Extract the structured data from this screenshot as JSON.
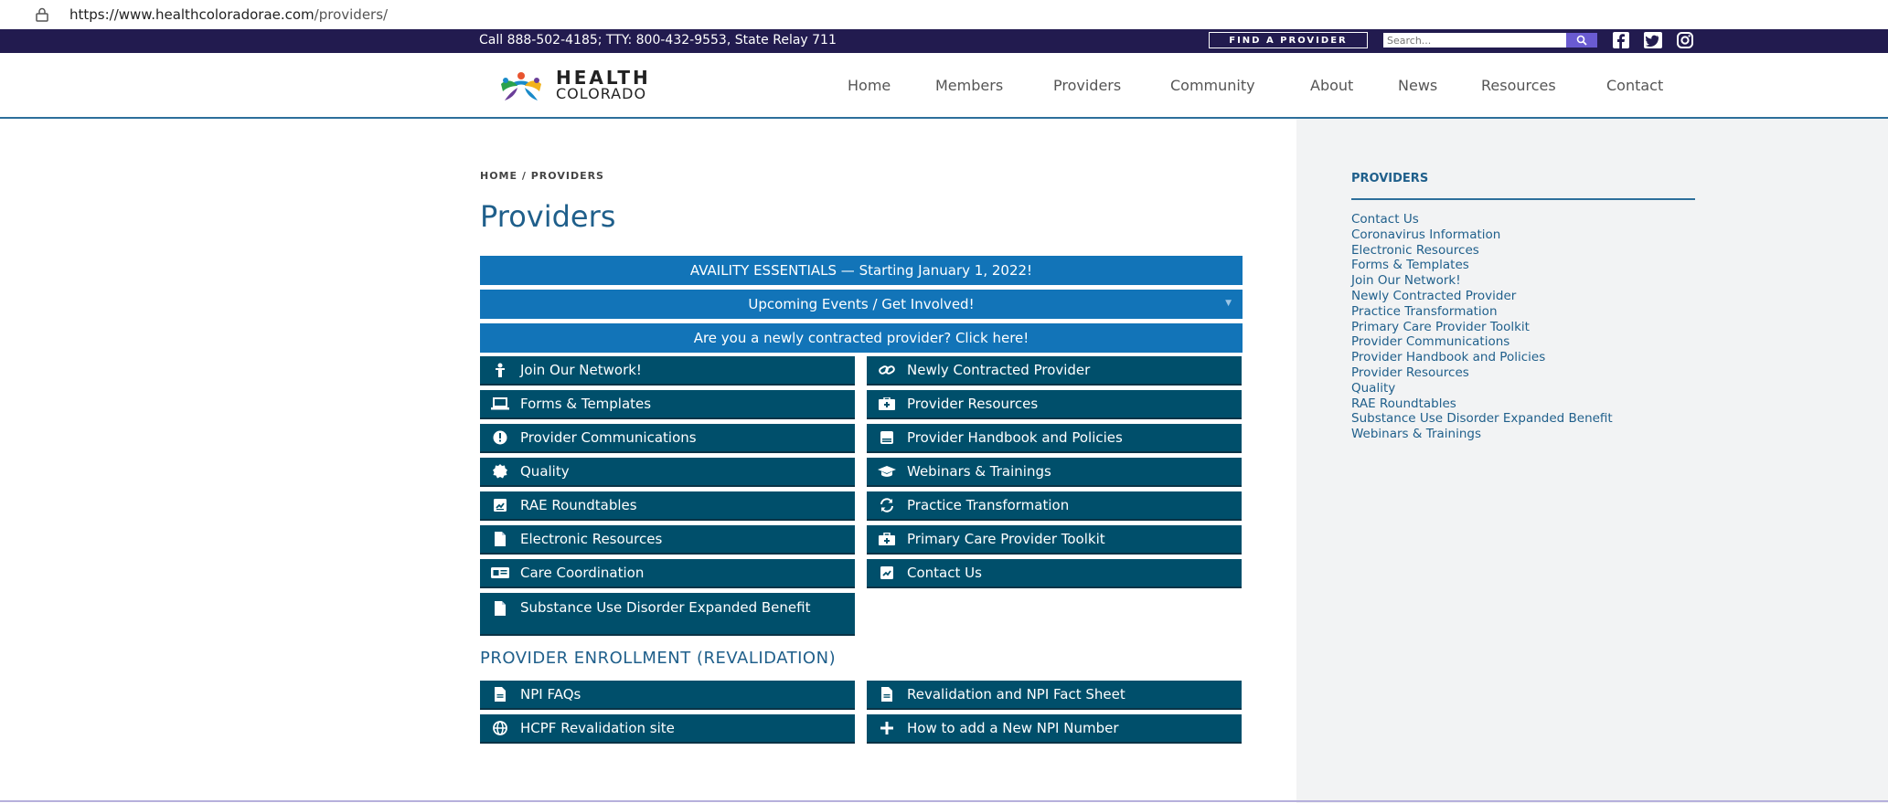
{
  "browser": {
    "url_host": "https://www.healthcoloradorae.com",
    "url_path": "/providers/"
  },
  "topbar": {
    "call_text": "Call  888-502-4185; TTY:  800-432-9553, State Relay 711",
    "find_label": "FIND A PROVIDER",
    "search_placeholder": "Search..."
  },
  "logo": {
    "line1": "HEALTH",
    "line2": "COLORADO"
  },
  "nav": [
    "Home",
    "Members",
    "Providers",
    "Community",
    "About",
    "News",
    "Resources",
    "Contact"
  ],
  "breadcrumb": {
    "home": "HOME",
    "sep": "/",
    "current": "PROVIDERS"
  },
  "page_title": "Providers",
  "banners": [
    "AVAILITY ESSENTIALS — Starting January 1, 2022!",
    "Upcoming Events / Get Involved!",
    "Are you a newly contracted provider? Click here!"
  ],
  "buttons": [
    {
      "label": "Join Our Network!",
      "icon": "person-icon"
    },
    {
      "label": "Newly Contracted Provider",
      "icon": "link-icon"
    },
    {
      "label": "Forms & Templates",
      "icon": "laptop-icon"
    },
    {
      "label": "Provider Resources",
      "icon": "medkit-icon"
    },
    {
      "label": "Provider Communications",
      "icon": "info-icon"
    },
    {
      "label": "Provider Handbook and Policies",
      "icon": "book-icon"
    },
    {
      "label": "Quality",
      "icon": "badge-icon"
    },
    {
      "label": "Webinars & Trainings",
      "icon": "graduation-cap-icon"
    },
    {
      "label": "RAE Roundtables",
      "icon": "checklist-icon"
    },
    {
      "label": "Practice Transformation",
      "icon": "refresh-icon"
    },
    {
      "label": "Electronic Resources",
      "icon": "document-icon"
    },
    {
      "label": "Primary Care Provider Toolkit",
      "icon": "toolkit-icon"
    },
    {
      "label": "Care Coordination",
      "icon": "id-card-icon"
    },
    {
      "label": "Contact Us",
      "icon": "checklist-icon"
    },
    {
      "label": "Substance Use Disorder Expanded Benefit",
      "icon": "document-icon"
    }
  ],
  "enrollment": {
    "heading": "PROVIDER ENROLLMENT (REVALIDATION)",
    "buttons": [
      {
        "label": "NPI FAQs",
        "icon": "document-icon"
      },
      {
        "label": "Revalidation and NPI Fact Sheet",
        "icon": "document-icon"
      },
      {
        "label": "HCPF Revalidation site",
        "icon": "globe-icon"
      },
      {
        "label": "How to add a New NPI Number",
        "icon": "plus-icon"
      }
    ]
  },
  "sidebar": {
    "title": "PROVIDERS",
    "items": [
      "Contact Us",
      "Coronavirus Information",
      "Electronic Resources",
      "Forms & Templates",
      "Join Our Network!",
      "Newly Contracted Provider",
      "Practice Transformation",
      "Primary Care Provider Toolkit",
      "Provider Communications",
      "Provider Handbook and Policies",
      "Provider Resources",
      "Quality",
      "RAE Roundtables",
      "Substance Use Disorder Expanded Benefit",
      "Webinars & Trainings"
    ]
  },
  "colors": {
    "topbar": "#221b4f",
    "banner": "#1274b8",
    "button": "#004f6b",
    "accent": "#1f5f8b"
  }
}
